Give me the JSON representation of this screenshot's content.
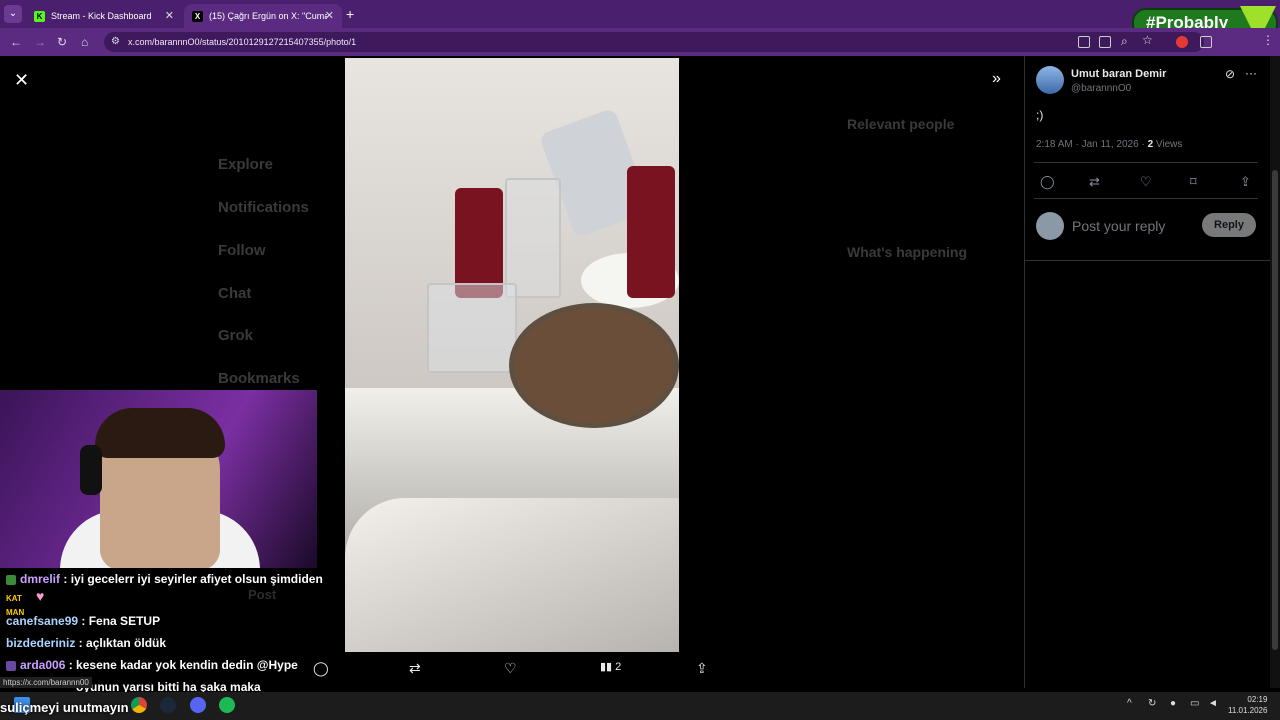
{
  "browser": {
    "tabs": [
      {
        "title": "Stream - Kick Dashboard",
        "favicon": "K"
      },
      {
        "title": "(15) Çağrı Ergün on X: \"Cumarte",
        "favicon": "X"
      }
    ],
    "url": "x.com/barannnO0/status/2010129127215407355/photo/1",
    "badge": "#Probably"
  },
  "viewer": {
    "bg_text": [
      "Explore",
      "Notifications",
      "Follow",
      "Chat",
      "Grok",
      "Bookmarks",
      "Relevant people",
      "What's happening",
      "Post"
    ],
    "actions": {
      "views": "2"
    }
  },
  "chat": [
    {
      "user": "dmrelif",
      "message": "iyi gecelerr iyi seyirler afiyet olsun şimdiden"
    },
    {
      "user": "canefsane99",
      "message": "Fena SETUP"
    },
    {
      "user": "bizdederiniz",
      "message": "açlıktan öldük"
    },
    {
      "user": "arda006",
      "message": "kesene kadar yok kendin dedin @Hype"
    },
    {
      "user": "",
      "message": "oyunun yarısı bitti ha şaka maka"
    }
  ],
  "status_url": "https://x.com/barannn00",
  "overlay_text": "suliçmeyi unutmayın",
  "tweet": {
    "name": "Umut baran Demir",
    "handle": "@barannnO0",
    "text": ";)",
    "time": "2:18 AM · Jan 11, 2026 · ",
    "views_count": "2",
    "views_label": " Views",
    "reply_placeholder": "Post your reply",
    "reply_button": "Reply"
  },
  "taskbar": {
    "time": "02:19",
    "date": "11.01.2026"
  }
}
